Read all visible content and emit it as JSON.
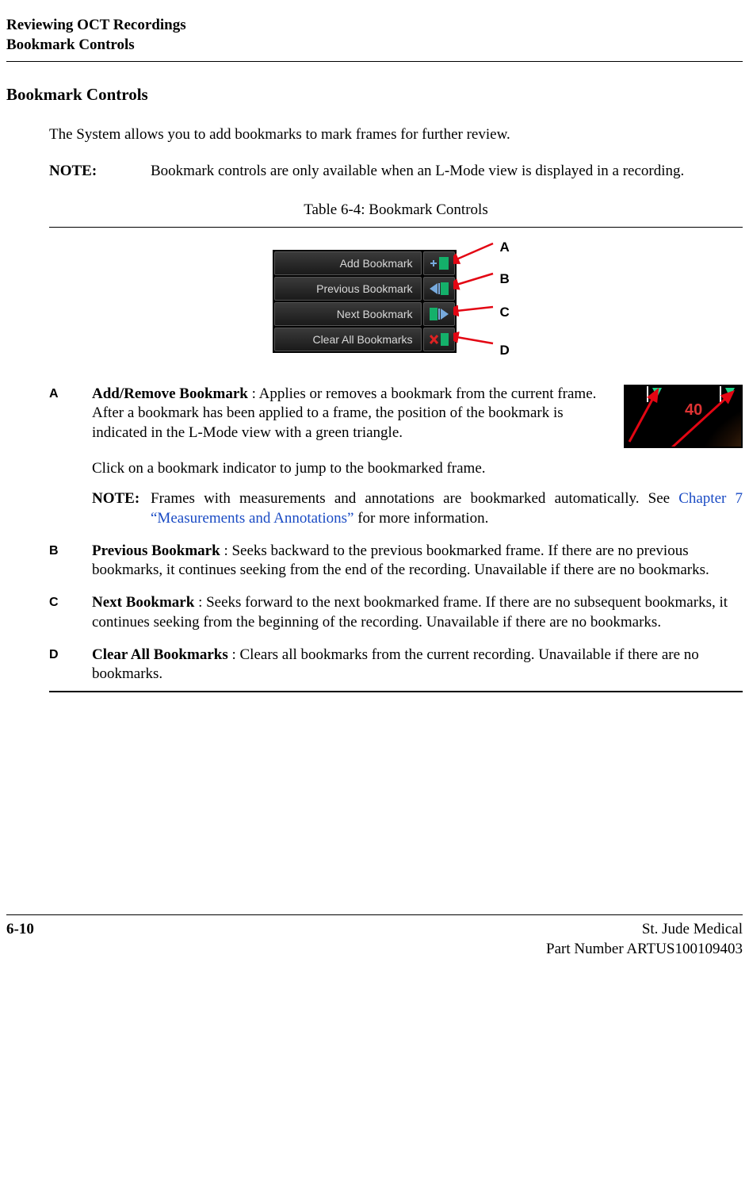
{
  "header": {
    "line1": "Reviewing OCT Recordings",
    "line2": "Bookmark Controls"
  },
  "section": {
    "title": "Bookmark Controls",
    "intro": "The System allows you to add bookmarks to mark frames for further review.",
    "note_label": "NOTE:",
    "note_text": "Bookmark controls are only available when an L-Mode view is displayed in a recording."
  },
  "table": {
    "caption": "Table 6-4:  Bookmark Controls"
  },
  "menu": {
    "items": [
      {
        "label": "Add Bookmark",
        "callout": "A",
        "icon": "add-bookmark-icon"
      },
      {
        "label": "Previous Bookmark",
        "callout": "B",
        "icon": "prev-bookmark-icon"
      },
      {
        "label": "Next Bookmark",
        "callout": "C",
        "icon": "next-bookmark-icon"
      },
      {
        "label": "Clear All Bookmarks",
        "callout": "D",
        "icon": "clear-bookmarks-icon"
      }
    ]
  },
  "definitions": {
    "A": {
      "title": "Add/Remove Bookmark",
      "body1": " : Applies or removes a bookmark from the current frame. After a bookmark has been applied to a frame, the position of the bookmark is indicated in the L-Mode view with a green triangle.",
      "body2": "Click on a bookmark indicator to jump to the bookmarked frame.",
      "note_label": "NOTE:",
      "note_pre": "Frames with measurements and annotations are bookmarked automatically. See ",
      "note_link": "Chapter 7 “Measurements and Annotations”",
      "note_post": " for more information."
    },
    "B": {
      "title": "Previous Bookmark",
      "body": " : Seeks backward to the previous bookmarked frame. If there are no previous bookmarks, it continues seeking from the end of the recording. Unavailable if there are no bookmarks."
    },
    "C": {
      "title": "Next Bookmark",
      "body": " : Seeks forward to the next bookmarked frame. If there are no subsequent bookmarks, it continues seeking from the beginning of the recording. Unavailable if there are no bookmarks."
    },
    "D": {
      "title": "Clear All Bookmarks",
      "body": " : Clears all bookmarks from the current recording. Unavailable if there are no bookmarks."
    }
  },
  "footer": {
    "page_num": "6-10",
    "company": "St. Jude Medical",
    "part": "Part Number ARTUS100109403"
  },
  "colors": {
    "arrow_red": "#e30613",
    "link_blue": "#1a4bc4"
  }
}
